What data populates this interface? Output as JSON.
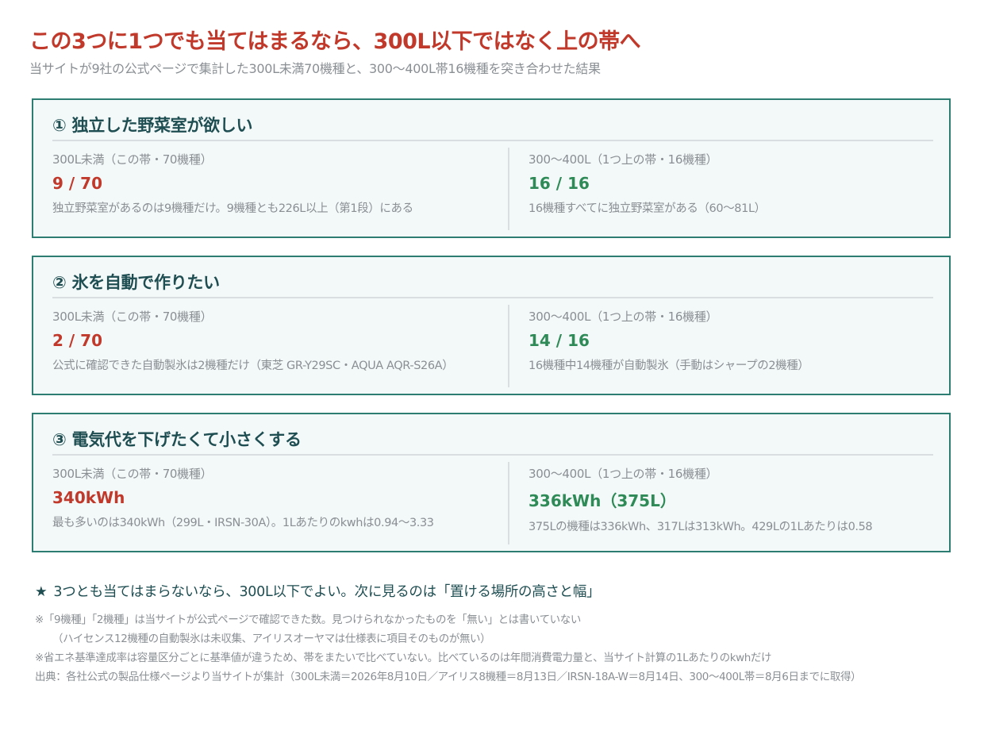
{
  "title": "この3つに1つでも当てはまるなら、300L以下ではなく上の帯へ",
  "subtitle": "当サイトが9社の公式ページで集計した300L未満70機種と、300〜400L帯16機種を突き合わせた結果",
  "cards": [
    {
      "title": "① 独立した野菜室が欲しい",
      "left": {
        "label": "300L未満（この帯・70機種）",
        "value": "9 / 70",
        "note": "独立野菜室があるのは9機種だけ。9機種とも226L以上（第1段）にある"
      },
      "right": {
        "label": "300〜400L（1つ上の帯・16機種）",
        "value": "16 / 16",
        "note": "16機種すべてに独立野菜室がある（60〜81L）"
      }
    },
    {
      "title": "② 氷を自動で作りたい",
      "left": {
        "label": "300L未満（この帯・70機種）",
        "value": "2 / 70",
        "note": "公式に確認できた自動製氷は2機種だけ（東芝 GR-Y29SC・AQUA AQR-S26A）"
      },
      "right": {
        "label": "300〜400L（1つ上の帯・16機種）",
        "value": "14 / 16",
        "note": "16機種中14機種が自動製氷（手動はシャープの2機種）"
      }
    },
    {
      "title": "③ 電気代を下げたくて小さくする",
      "left": {
        "label": "300L未満（この帯・70機種）",
        "value": "340kWh",
        "note": "最も多いのは340kWh（299L・IRSN-30A）。1Lあたりのkwhは0.94〜3.33"
      },
      "right": {
        "label": "300〜400L（1つ上の帯・16機種）",
        "value": "336kWh（375L）",
        "note": "375Lの機種は336kWh、317Lは313kWh。429Lの1Lあたりは0.58"
      }
    }
  ],
  "conclusion": {
    "star": "★",
    "text": "3つとも当てはまらないなら、300L以下でよい。次に見るのは「置ける場所の高さと幅」"
  },
  "notes": [
    "※「9機種」「2機種」は当サイトが公式ページで確認できた数。見つけられなかったものを「無い」とは書いていない",
    "（ハイセンス12機種の自動製氷は未収集、アイリスオーヤマは仕様表に項目そのものが無い）",
    "※省エネ基準達成率は容量区分ごとに基準値が違うため、帯をまたいで比べていない。比べているのは年間消費電力量と、当サイト計算の1Lあたりのkwhだけ",
    "出典：各社公式の製品仕様ページより当サイトが集計（300L未満＝2026年8月10日／アイリス8機種＝8月13日／IRSN-18A-W＝8月14日、300〜400L帯＝8月6日までに取得）"
  ],
  "colors": {
    "title": "#c0392b",
    "card_border": "#2e7d73",
    "card_bg": "#f3f8f8",
    "value_bad": "#c0392b",
    "value_good": "#2e8a56",
    "heading": "#1f4e52"
  }
}
